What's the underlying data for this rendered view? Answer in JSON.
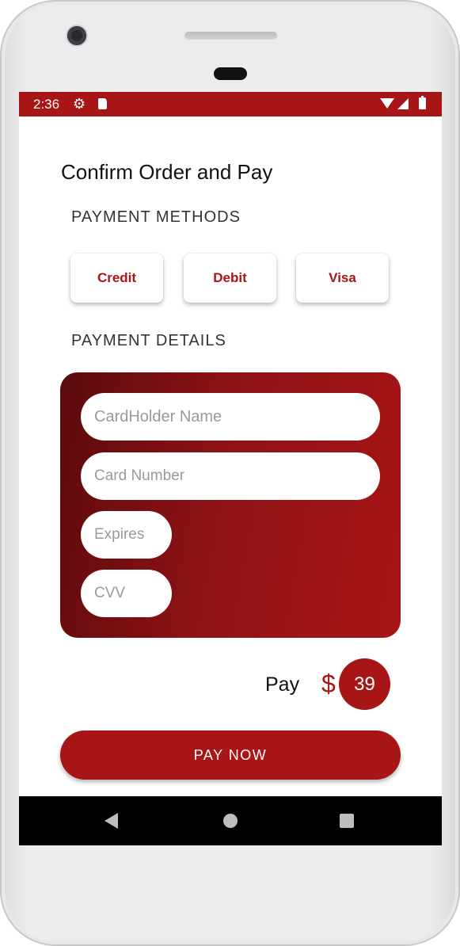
{
  "status_bar": {
    "time": "2:36",
    "icons": [
      "gear-icon",
      "sd-card-icon",
      "wifi-icon",
      "signal-icon",
      "battery-icon"
    ]
  },
  "page": {
    "title": "Confirm Order and Pay"
  },
  "payment_methods": {
    "heading": "PAYMENT METHODS",
    "options": [
      {
        "label": "Credit"
      },
      {
        "label": "Debit"
      },
      {
        "label": "Visa"
      }
    ]
  },
  "payment_details": {
    "heading": "PAYMENT DETAILS",
    "fields": {
      "cardholder_name": {
        "placeholder": "CardHolder Name",
        "value": ""
      },
      "card_number": {
        "placeholder": "Card Number",
        "value": ""
      },
      "expires": {
        "placeholder": "Expires",
        "value": ""
      },
      "cvv": {
        "placeholder": "CVV",
        "value": ""
      }
    }
  },
  "summary": {
    "pay_label": "Pay",
    "currency_symbol": "$",
    "amount": "39"
  },
  "actions": {
    "pay_now_label": "PAY NOW"
  },
  "navigation": {
    "icons": [
      "back-icon",
      "home-icon",
      "recents-icon"
    ]
  },
  "colors": {
    "accent": "#a81517",
    "card_gradient_dark": "#5a0a0c",
    "background": "#ffffff"
  }
}
